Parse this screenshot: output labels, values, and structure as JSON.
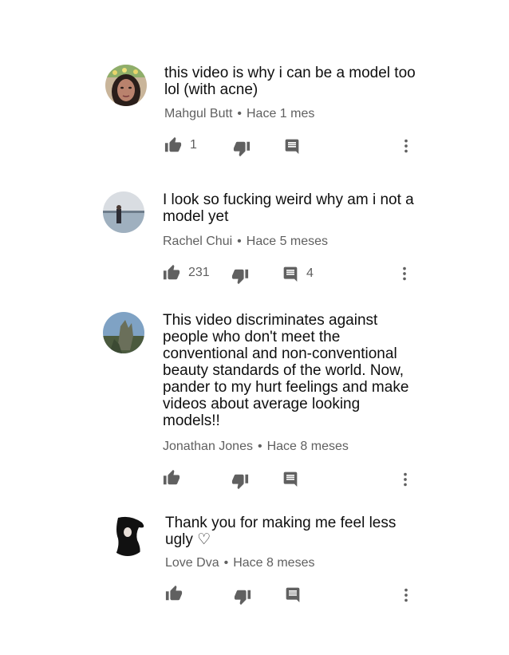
{
  "comments": [
    {
      "text": "this video is why i can be a model too lol (with acne)",
      "author": "Mahgul Butt",
      "separator": "•",
      "time": "Hace 1 mes",
      "likes": "1",
      "replies": ""
    },
    {
      "text": "I look so fucking weird why am i not a model yet",
      "author": "Rachel Chui",
      "separator": "•",
      "time": "Hace 5 meses",
      "likes": "231",
      "replies": "4"
    },
    {
      "text": "This video discriminates against people who don't meet the conventional and non-conventional beauty standards of the world. Now, pander to my hurt feelings and make videos about average looking models!!",
      "author": "Jonathan Jones",
      "separator": "•",
      "time": "Hace 8 meses",
      "likes": "",
      "replies": ""
    },
    {
      "text": "Thank you for making me feel less ugly ♡",
      "author": "Love Dva",
      "separator": "•",
      "time": "Hace 8 meses",
      "likes": "",
      "replies": ""
    }
  ],
  "icons": {
    "like": "thumb-up-icon",
    "dislike": "thumb-down-icon",
    "reply": "comment-icon",
    "more": "more-vert-icon"
  },
  "colors": {
    "icon": "#606060",
    "meta": "#606060",
    "text": "#0f0f0f"
  }
}
